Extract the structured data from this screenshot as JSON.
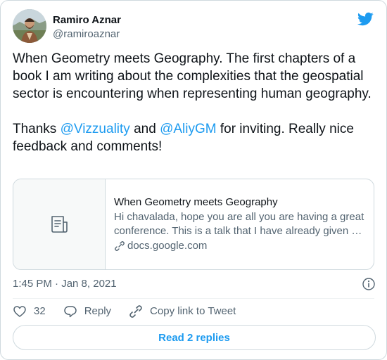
{
  "author": {
    "display_name": "Ramiro Aznar",
    "handle": "@ramiroaznar",
    "avatar": "avatar-photo"
  },
  "brand": {
    "icon": "twitter-bird-icon",
    "color": "#1d9bf0"
  },
  "tweet": {
    "paragraph1": "When Geometry meets Geography. The first chapters of a book I am writing about the complexities that the geospatial sector is encountering when representing human geography.",
    "paragraph2_pre": "Thanks ",
    "mention1": "@Vizzuality",
    "paragraph2_mid": " and ",
    "mention2": "@AliyGM",
    "paragraph2_post": " for inviting. Really nice feedback and comments!"
  },
  "link_card": {
    "thumb_icon": "document-icon",
    "title": "When Geometry meets Geography",
    "description": "Hi chavalada, hope you are all you are having a great conference. This is a talk that I have already given …",
    "domain": "docs.google.com",
    "domain_icon": "link-icon"
  },
  "meta": {
    "timestamp": "1:45 PM · Jan 8, 2021",
    "info_icon": "info-icon"
  },
  "actions": {
    "like_count": "32",
    "reply_label": "Reply",
    "copy_label": "Copy link to Tweet"
  },
  "replies_button": {
    "label": "Read 2 replies"
  },
  "colors": {
    "text": "#0f1419",
    "secondary": "#536471",
    "accent": "#1d9bf0",
    "border": "#cfd9de"
  }
}
